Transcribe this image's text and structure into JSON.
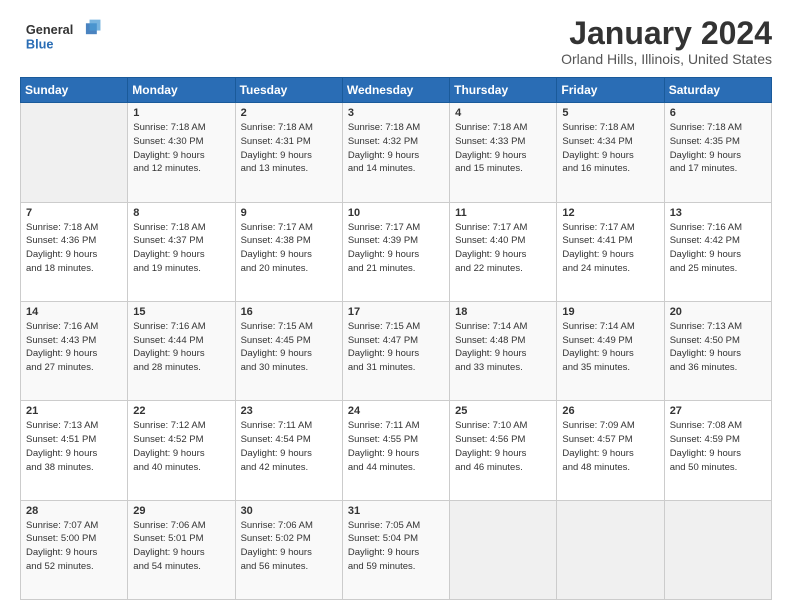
{
  "header": {
    "logo_general": "General",
    "logo_blue": "Blue",
    "month_title": "January 2024",
    "location": "Orland Hills, Illinois, United States"
  },
  "days_of_week": [
    "Sunday",
    "Monday",
    "Tuesday",
    "Wednesday",
    "Thursday",
    "Friday",
    "Saturday"
  ],
  "weeks": [
    [
      {
        "day": "",
        "empty": true
      },
      {
        "day": "1",
        "sunrise": "7:18 AM",
        "sunset": "4:30 PM",
        "daylight": "9 hours and 12 minutes."
      },
      {
        "day": "2",
        "sunrise": "7:18 AM",
        "sunset": "4:31 PM",
        "daylight": "9 hours and 13 minutes."
      },
      {
        "day": "3",
        "sunrise": "7:18 AM",
        "sunset": "4:32 PM",
        "daylight": "9 hours and 14 minutes."
      },
      {
        "day": "4",
        "sunrise": "7:18 AM",
        "sunset": "4:33 PM",
        "daylight": "9 hours and 15 minutes."
      },
      {
        "day": "5",
        "sunrise": "7:18 AM",
        "sunset": "4:34 PM",
        "daylight": "9 hours and 16 minutes."
      },
      {
        "day": "6",
        "sunrise": "7:18 AM",
        "sunset": "4:35 PM",
        "daylight": "9 hours and 17 minutes."
      }
    ],
    [
      {
        "day": "7",
        "sunrise": "7:18 AM",
        "sunset": "4:36 PM",
        "daylight": "9 hours and 18 minutes."
      },
      {
        "day": "8",
        "sunrise": "7:18 AM",
        "sunset": "4:37 PM",
        "daylight": "9 hours and 19 minutes."
      },
      {
        "day": "9",
        "sunrise": "7:17 AM",
        "sunset": "4:38 PM",
        "daylight": "9 hours and 20 minutes."
      },
      {
        "day": "10",
        "sunrise": "7:17 AM",
        "sunset": "4:39 PM",
        "daylight": "9 hours and 21 minutes."
      },
      {
        "day": "11",
        "sunrise": "7:17 AM",
        "sunset": "4:40 PM",
        "daylight": "9 hours and 22 minutes."
      },
      {
        "day": "12",
        "sunrise": "7:17 AM",
        "sunset": "4:41 PM",
        "daylight": "9 hours and 24 minutes."
      },
      {
        "day": "13",
        "sunrise": "7:16 AM",
        "sunset": "4:42 PM",
        "daylight": "9 hours and 25 minutes."
      }
    ],
    [
      {
        "day": "14",
        "sunrise": "7:16 AM",
        "sunset": "4:43 PM",
        "daylight": "9 hours and 27 minutes."
      },
      {
        "day": "15",
        "sunrise": "7:16 AM",
        "sunset": "4:44 PM",
        "daylight": "9 hours and 28 minutes."
      },
      {
        "day": "16",
        "sunrise": "7:15 AM",
        "sunset": "4:45 PM",
        "daylight": "9 hours and 30 minutes."
      },
      {
        "day": "17",
        "sunrise": "7:15 AM",
        "sunset": "4:47 PM",
        "daylight": "9 hours and 31 minutes."
      },
      {
        "day": "18",
        "sunrise": "7:14 AM",
        "sunset": "4:48 PM",
        "daylight": "9 hours and 33 minutes."
      },
      {
        "day": "19",
        "sunrise": "7:14 AM",
        "sunset": "4:49 PM",
        "daylight": "9 hours and 35 minutes."
      },
      {
        "day": "20",
        "sunrise": "7:13 AM",
        "sunset": "4:50 PM",
        "daylight": "9 hours and 36 minutes."
      }
    ],
    [
      {
        "day": "21",
        "sunrise": "7:13 AM",
        "sunset": "4:51 PM",
        "daylight": "9 hours and 38 minutes."
      },
      {
        "day": "22",
        "sunrise": "7:12 AM",
        "sunset": "4:52 PM",
        "daylight": "9 hours and 40 minutes."
      },
      {
        "day": "23",
        "sunrise": "7:11 AM",
        "sunset": "4:54 PM",
        "daylight": "9 hours and 42 minutes."
      },
      {
        "day": "24",
        "sunrise": "7:11 AM",
        "sunset": "4:55 PM",
        "daylight": "9 hours and 44 minutes."
      },
      {
        "day": "25",
        "sunrise": "7:10 AM",
        "sunset": "4:56 PM",
        "daylight": "9 hours and 46 minutes."
      },
      {
        "day": "26",
        "sunrise": "7:09 AM",
        "sunset": "4:57 PM",
        "daylight": "9 hours and 48 minutes."
      },
      {
        "day": "27",
        "sunrise": "7:08 AM",
        "sunset": "4:59 PM",
        "daylight": "9 hours and 50 minutes."
      }
    ],
    [
      {
        "day": "28",
        "sunrise": "7:07 AM",
        "sunset": "5:00 PM",
        "daylight": "9 hours and 52 minutes."
      },
      {
        "day": "29",
        "sunrise": "7:06 AM",
        "sunset": "5:01 PM",
        "daylight": "9 hours and 54 minutes."
      },
      {
        "day": "30",
        "sunrise": "7:06 AM",
        "sunset": "5:02 PM",
        "daylight": "9 hours and 56 minutes."
      },
      {
        "day": "31",
        "sunrise": "7:05 AM",
        "sunset": "5:04 PM",
        "daylight": "9 hours and 59 minutes."
      },
      {
        "day": "",
        "empty": true
      },
      {
        "day": "",
        "empty": true
      },
      {
        "day": "",
        "empty": true
      }
    ]
  ]
}
